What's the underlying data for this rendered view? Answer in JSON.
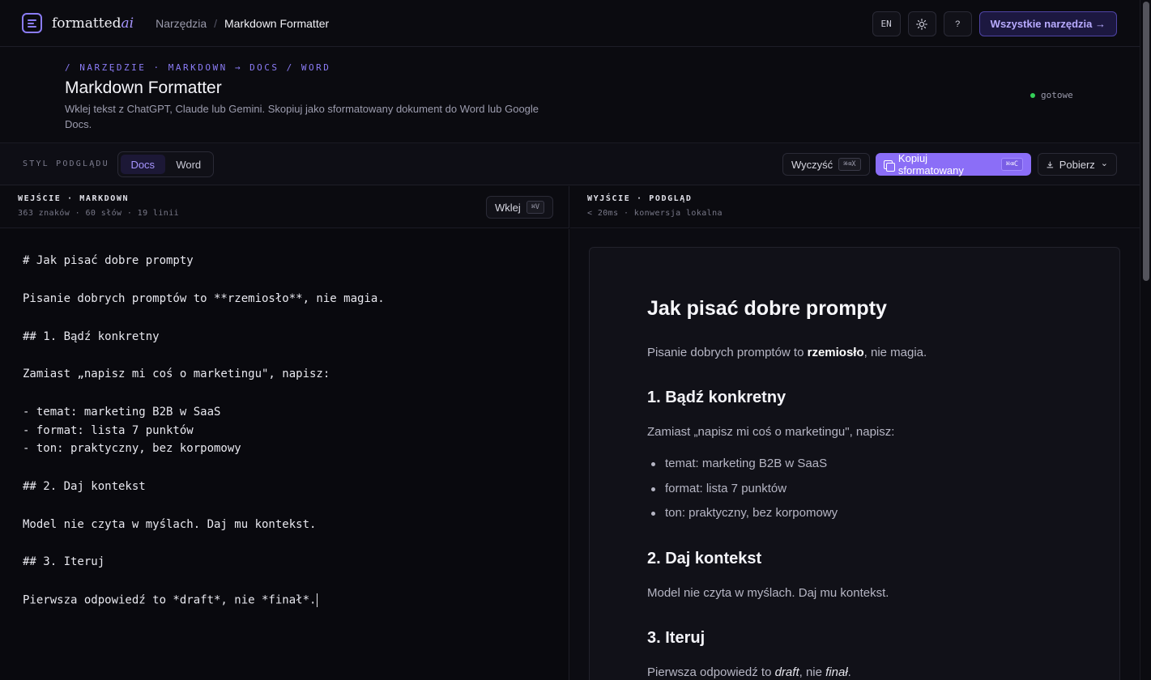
{
  "brand": {
    "name": "formatted",
    "suffix": "ai"
  },
  "breadcrumb": {
    "parent": "Narzędzia",
    "separator": "/",
    "current": "Markdown Formatter"
  },
  "nav": {
    "lang": "EN",
    "help": "?",
    "all_tools": "Wszystkie narzędzia →"
  },
  "tool": {
    "kicker": "/ NARZĘDZIE · MARKDOWN → DOCS / WORD",
    "title": "Markdown Formatter",
    "description": "Wklej tekst z ChatGPT, Claude lub Gemini. Skopiuj jako sformatowany dokument do Word lub Google Docs.",
    "status": "gotowe"
  },
  "toolbar": {
    "style_label": "STYL PODGLĄDU",
    "styles": [
      "Docs",
      "Word"
    ],
    "active_style": "Docs",
    "clear_label": "Wyczyść",
    "clear_kbd": "⌘⌫X",
    "copy_label": "Kopiuj sformatowany",
    "copy_kbd": "⌘⌫C",
    "download_label": "Pobierz",
    "download_caret": "⌄"
  },
  "input_panel": {
    "title": "WEJŚCIE · MARKDOWN",
    "stats": "363 znaków · 60 słów · 19 linii",
    "paste_label": "Wklej",
    "paste_kbd": "⌘V",
    "lines": [
      "# Jak pisać dobre prompty",
      "Pisanie dobrych promptów to **rzemiosło**, nie magia.",
      "## 1. Bądź konkretny",
      "Zamiast „napisz mi coś o marketingu\", napisz:",
      "- temat: marketing B2B w SaaS",
      "- format: lista 7 punktów",
      "- ton: praktyczny, bez korpomowy",
      "## 2. Daj kontekst",
      "Model nie czyta w myślach. Daj mu kontekst.",
      "## 3. Iteruj",
      "Pierwsza odpowiedź to *draft*, nie *finał*."
    ]
  },
  "output_panel": {
    "title": "WYJŚCIE · PODGLĄD",
    "stats": "< 20ms · konwersja lokalna",
    "doc": {
      "h1": "Jak pisać dobre prompty",
      "p1_before": "Pisanie dobrych promptów to ",
      "p1_bold": "rzemiosło",
      "p1_after": ", nie magia.",
      "h2_1": "1. Bądź konkretny",
      "p2": "Zamiast „napisz mi coś o marketingu\", napisz:",
      "list": [
        "temat: marketing B2B w SaaS",
        "format: lista 7 punktów",
        "ton: praktyczny, bez korpomowy"
      ],
      "h2_2": "2. Daj kontekst",
      "p3": "Model nie czyta w myślach. Daj mu kontekst.",
      "h2_3": "3. Iteruj",
      "p4_before": "Pierwsza odpowiedź to ",
      "p4_em1": "draft",
      "p4_mid": ", nie ",
      "p4_em2": "finał",
      "p4_after": "."
    }
  },
  "colors": {
    "accent": "#8b6ef7",
    "background": "#0b0b10",
    "status_ok": "#34d058"
  }
}
